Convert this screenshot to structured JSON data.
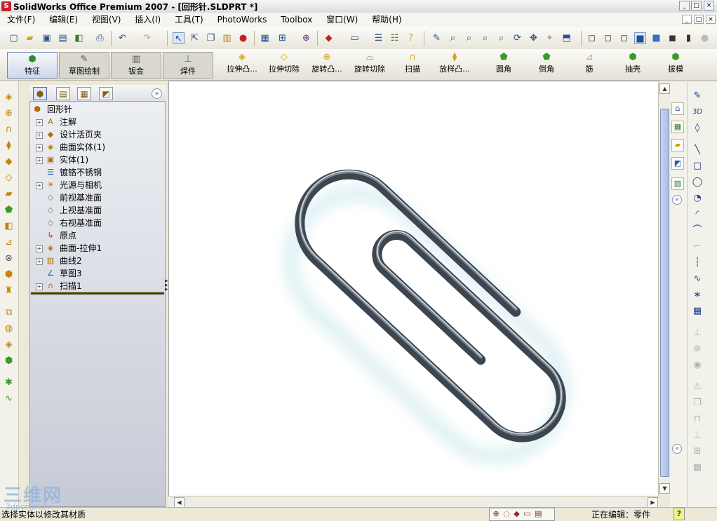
{
  "window": {
    "title": "SolidWorks Office Premium 2007 - [回形针.SLDPRT *]",
    "logo_text": "S",
    "controls": [
      "_",
      "□",
      "×"
    ]
  },
  "menu": {
    "items": [
      "文件(F)",
      "编辑(E)",
      "视图(V)",
      "插入(I)",
      "工具(T)",
      "PhotoWorks",
      "Toolbox",
      "窗口(W)",
      "帮助(H)"
    ],
    "mdi_controls": [
      "_",
      "□",
      "×"
    ]
  },
  "toolbar": {
    "icons": [
      "new-icon",
      "open-icon",
      "save-icon",
      "print-preview-icon",
      "print-icon",
      "undo-icon",
      "redo-icon",
      "select-icon",
      "select-filter-icon",
      "copy-icon",
      "paste-icon",
      "traffic-light-icon",
      "grid-icon",
      "edit-appearance-icon",
      "photoworks-icon",
      "rebuild-icon",
      "options-icon",
      "list-icon",
      "checklist-icon",
      "help-icon",
      "measure-icon",
      "zoom-fit-icon",
      "zoom-area-icon",
      "zoom-in-icon",
      "zoom-out-icon",
      "rotate-icon",
      "pan-icon",
      "move-icon",
      "view-orientation-icon",
      "wireframe-icon",
      "hidden-lines-icon",
      "hidden-removed-icon",
      "shaded-edges-icon",
      "shaded-icon",
      "shadows-icon",
      "perspective-icon",
      "realview-icon"
    ]
  },
  "command_manager": {
    "tabs": [
      {
        "label": "特征",
        "icon": "features-icon"
      },
      {
        "label": "草图绘制",
        "icon": "sketch-icon"
      },
      {
        "label": "钣金",
        "icon": "sheet-metal-icon"
      },
      {
        "label": "焊件",
        "icon": "weldments-icon"
      }
    ],
    "buttons": [
      {
        "label": "拉伸凸...",
        "icon": "extruded-boss-icon"
      },
      {
        "label": "拉伸切除",
        "icon": "extruded-cut-icon"
      },
      {
        "label": "旋转凸...",
        "icon": "revolved-boss-icon"
      },
      {
        "label": "旋转切除",
        "icon": "revolved-cut-icon"
      },
      {
        "label": "扫描",
        "icon": "sweep-icon"
      },
      {
        "label": "放样凸...",
        "icon": "loft-icon"
      },
      {
        "label": "圆角",
        "icon": "fillet-icon"
      },
      {
        "label": "倒角",
        "icon": "chamfer-icon"
      },
      {
        "label": "筋",
        "icon": "rib-icon"
      },
      {
        "label": "抽壳",
        "icon": "shell-icon"
      },
      {
        "label": "拔模",
        "icon": "draft-icon"
      }
    ]
  },
  "feature_manager": {
    "tabs": [
      "feature-tree-icon",
      "property-manager-icon",
      "configuration-manager-icon",
      "display-manager-icon"
    ],
    "expand_icon": "»",
    "root": {
      "label": "回形针",
      "icon": "part-icon"
    },
    "items": [
      {
        "label": "注解",
        "icon": "annotations-icon",
        "expandable": true
      },
      {
        "label": "设计活页夹",
        "icon": "design-binder-icon",
        "expandable": true
      },
      {
        "label": "曲面实体(1)",
        "icon": "surface-bodies-icon",
        "expandable": true
      },
      {
        "label": "实体(1)",
        "icon": "solid-bodies-icon",
        "expandable": true
      },
      {
        "label": "镀铬不锈钢",
        "icon": "material-icon",
        "expandable": false
      },
      {
        "label": "光源与相机",
        "icon": "lights-cameras-icon",
        "expandable": true
      },
      {
        "label": "前视基准面",
        "icon": "plane-icon",
        "expandable": false
      },
      {
        "label": "上视基准面",
        "icon": "plane-icon",
        "expandable": false
      },
      {
        "label": "右视基准面",
        "icon": "plane-icon",
        "expandable": false
      },
      {
        "label": "原点",
        "icon": "origin-icon",
        "expandable": false
      },
      {
        "label": "曲面-拉伸1",
        "icon": "surface-extrude-icon",
        "expandable": true
      },
      {
        "label": "曲线2",
        "icon": "curve-icon",
        "expandable": true
      },
      {
        "label": "草图3",
        "icon": "sketch3-icon",
        "expandable": false
      },
      {
        "label": "扫描1",
        "icon": "sweep1-icon",
        "expandable": true
      }
    ]
  },
  "task_pane": {
    "icons": [
      "solidworks-resources-icon",
      "design-library-icon",
      "file-explorer-icon",
      "view-palette-icon",
      "appearances-icon"
    ],
    "collapse_icon": "«"
  },
  "sketch_toolbar": {
    "icons": [
      "sketch-icon",
      "3d-sketch-icon",
      "smart-dimension-icon",
      "line-icon",
      "rectangle-icon",
      "circle-icon",
      "centerpoint-arc-icon",
      "tangent-arc-icon",
      "3point-arc-icon",
      "sketch-fillet-icon",
      "centerline-icon",
      "spline-icon",
      "point-icon",
      "trim-icon",
      "offset-icon",
      "mirror-icon",
      "convert-entities-icon",
      "linear-pattern-icon",
      "add-relation-icon",
      "display-relations-icon",
      "repair-sketch-icon",
      "quick-snaps-icon",
      "rapid-sketch-icon",
      "move-entities-icon"
    ]
  },
  "status": {
    "left": "选择实体以修改其材质",
    "right": "正在编辑：零件",
    "help_icon": "?"
  },
  "watermark": {
    "text": "三维网",
    "sub": "3dportal.cn"
  },
  "colors": {
    "accent_blue": "#2d5a9f",
    "feature_orange": "#c9830a",
    "paperclip_steel": "#4c5660",
    "viewport_bg": "#ffffff"
  }
}
